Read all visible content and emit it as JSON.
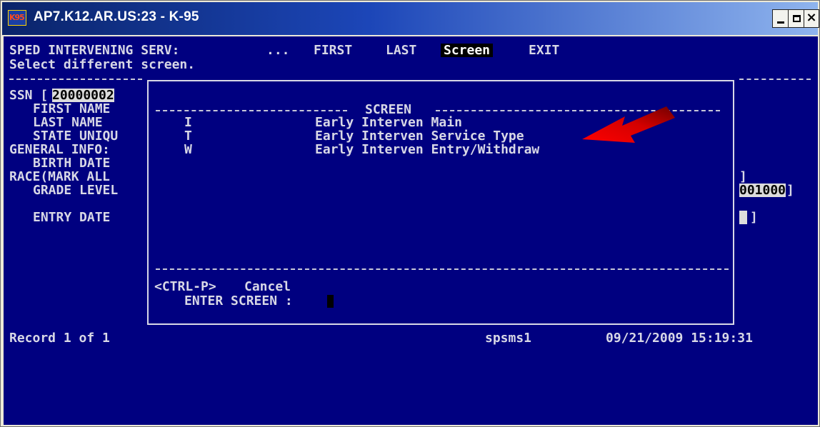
{
  "window": {
    "title": "AP7.K12.AR.US:23 - K-95",
    "icon_label": "K95",
    "controls": [
      "minimize",
      "maximize",
      "close"
    ]
  },
  "terminal": {
    "header": {
      "program": "SPED INTERVENING SERV:",
      "ellipsis": "...",
      "menu": {
        "first": "FIRST",
        "last": "LAST",
        "screen": "Screen",
        "exit": "EXIT"
      },
      "prompt": "Select different screen."
    },
    "fields": {
      "ssn_label": "SSN [",
      "ssn_value": "20000002",
      "first_name": "FIRST NAME",
      "last_name": "LAST NAME",
      "state_unique": "STATE UNIQU",
      "general_info": "GENERAL INFO:",
      "birth_date": "BIRTH DATE",
      "race": "RACE(MARK ALL",
      "grade_level": "GRADE LEVEL",
      "entry_date": "ENTRY DATE"
    },
    "right_fields": {
      "race_close": "]",
      "grade_value": "001000",
      "grade_close": "]",
      "entry_close": "]"
    },
    "dialog": {
      "title": "SCREEN",
      "options": [
        {
          "key": "I",
          "label": "Early Interven Main"
        },
        {
          "key": "T",
          "label": "Early Interven Service Type"
        },
        {
          "key": "W",
          "label": "Early Interven Entry/Withdraw"
        }
      ],
      "cancel_key": "<CTRL-P>",
      "cancel_label": "Cancel",
      "enter_prompt": "ENTER SCREEN :"
    },
    "status": {
      "record": "Record 1 of 1",
      "user": "spsms1",
      "datetime": "09/21/2009 15:19:31"
    },
    "colors": {
      "background": "#000080",
      "text": "#d8d8e6",
      "annotation_arrow": "#e00000"
    }
  }
}
